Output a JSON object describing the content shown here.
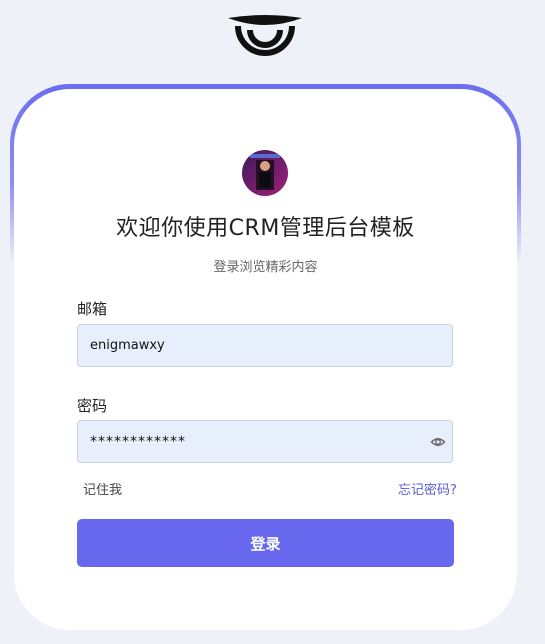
{
  "logo": {
    "icon": "brand-logo-icon"
  },
  "header": {
    "title": "欢迎你使用CRM管理后台模板",
    "subtitle": "登录浏览精彩内容"
  },
  "form": {
    "email_label": "邮箱",
    "email_value": "enigmawxy",
    "password_label": "密码",
    "password_value": "************",
    "remember_label": "记住我",
    "forgot_link": "忘记密码?",
    "submit_label": "登录",
    "password_toggle_icon": "eye-icon"
  },
  "colors": {
    "background": "#eef1f7",
    "accent": "#6868ee",
    "input_bg": "#e8effc",
    "link": "#5a5ad8"
  }
}
